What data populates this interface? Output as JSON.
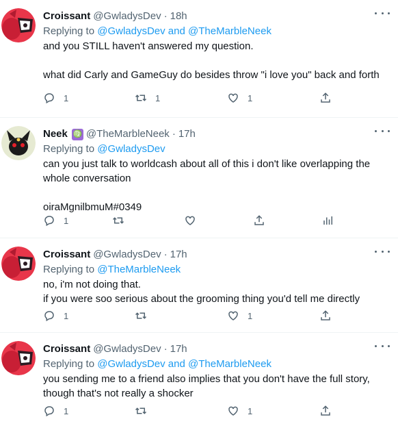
{
  "tweets": [
    {
      "name": "Croissant",
      "handle": "@GwladysDev",
      "time": "18h",
      "reply_prefix": "Replying to ",
      "reply_to": "@GwladysDev and @TheMarbleNeek",
      "lines": [
        "and you STILL haven't answered my question.",
        "",
        "what did Carly and GameGuy do besides throw \"i love you\" back and forth"
      ],
      "replies": "1",
      "retweets": "1",
      "likes": "1"
    },
    {
      "name": "Neek",
      "badge": "♍",
      "handle": "@TheMarbleNeek",
      "time": "17h",
      "reply_prefix": "Replying to ",
      "reply_to": "@GwladysDev",
      "lines": [
        "can you just talk to worldcash about all of this i don't like overlapping the",
        "whole conversation",
        "",
        "oiraMgnilbmuM#0349"
      ],
      "replies": "1",
      "retweets": "",
      "likes": ""
    },
    {
      "name": "Croissant",
      "handle": "@GwladysDev",
      "time": "17h",
      "reply_prefix": "Replying to ",
      "reply_to": "@TheMarbleNeek",
      "lines": [
        "no, i'm not doing that.",
        "if you were soo serious about the grooming thing you'd tell me directly"
      ],
      "replies": "1",
      "retweets": "",
      "likes": "1"
    },
    {
      "name": "Croissant",
      "handle": "@GwladysDev",
      "time": "17h",
      "reply_prefix": "Replying to ",
      "reply_to": "@GwladysDev and @TheMarbleNeek",
      "lines": [
        "you sending me to a friend also implies that you don't have the full story,",
        "though that's not really a shocker"
      ],
      "replies": "1",
      "retweets": "",
      "likes": "1"
    }
  ],
  "separator": "·",
  "icons": {
    "reply": "reply-icon",
    "retweet": "retweet-icon",
    "like": "heart-icon",
    "share": "share-icon",
    "analytics": "analytics-icon",
    "more": "more-icon"
  },
  "colors": {
    "link": "#1d9bf0",
    "muted": "#536471",
    "text": "#0f1419",
    "croissant_avatar": "#e8364a",
    "neek_avatar": "#e6ead2"
  }
}
